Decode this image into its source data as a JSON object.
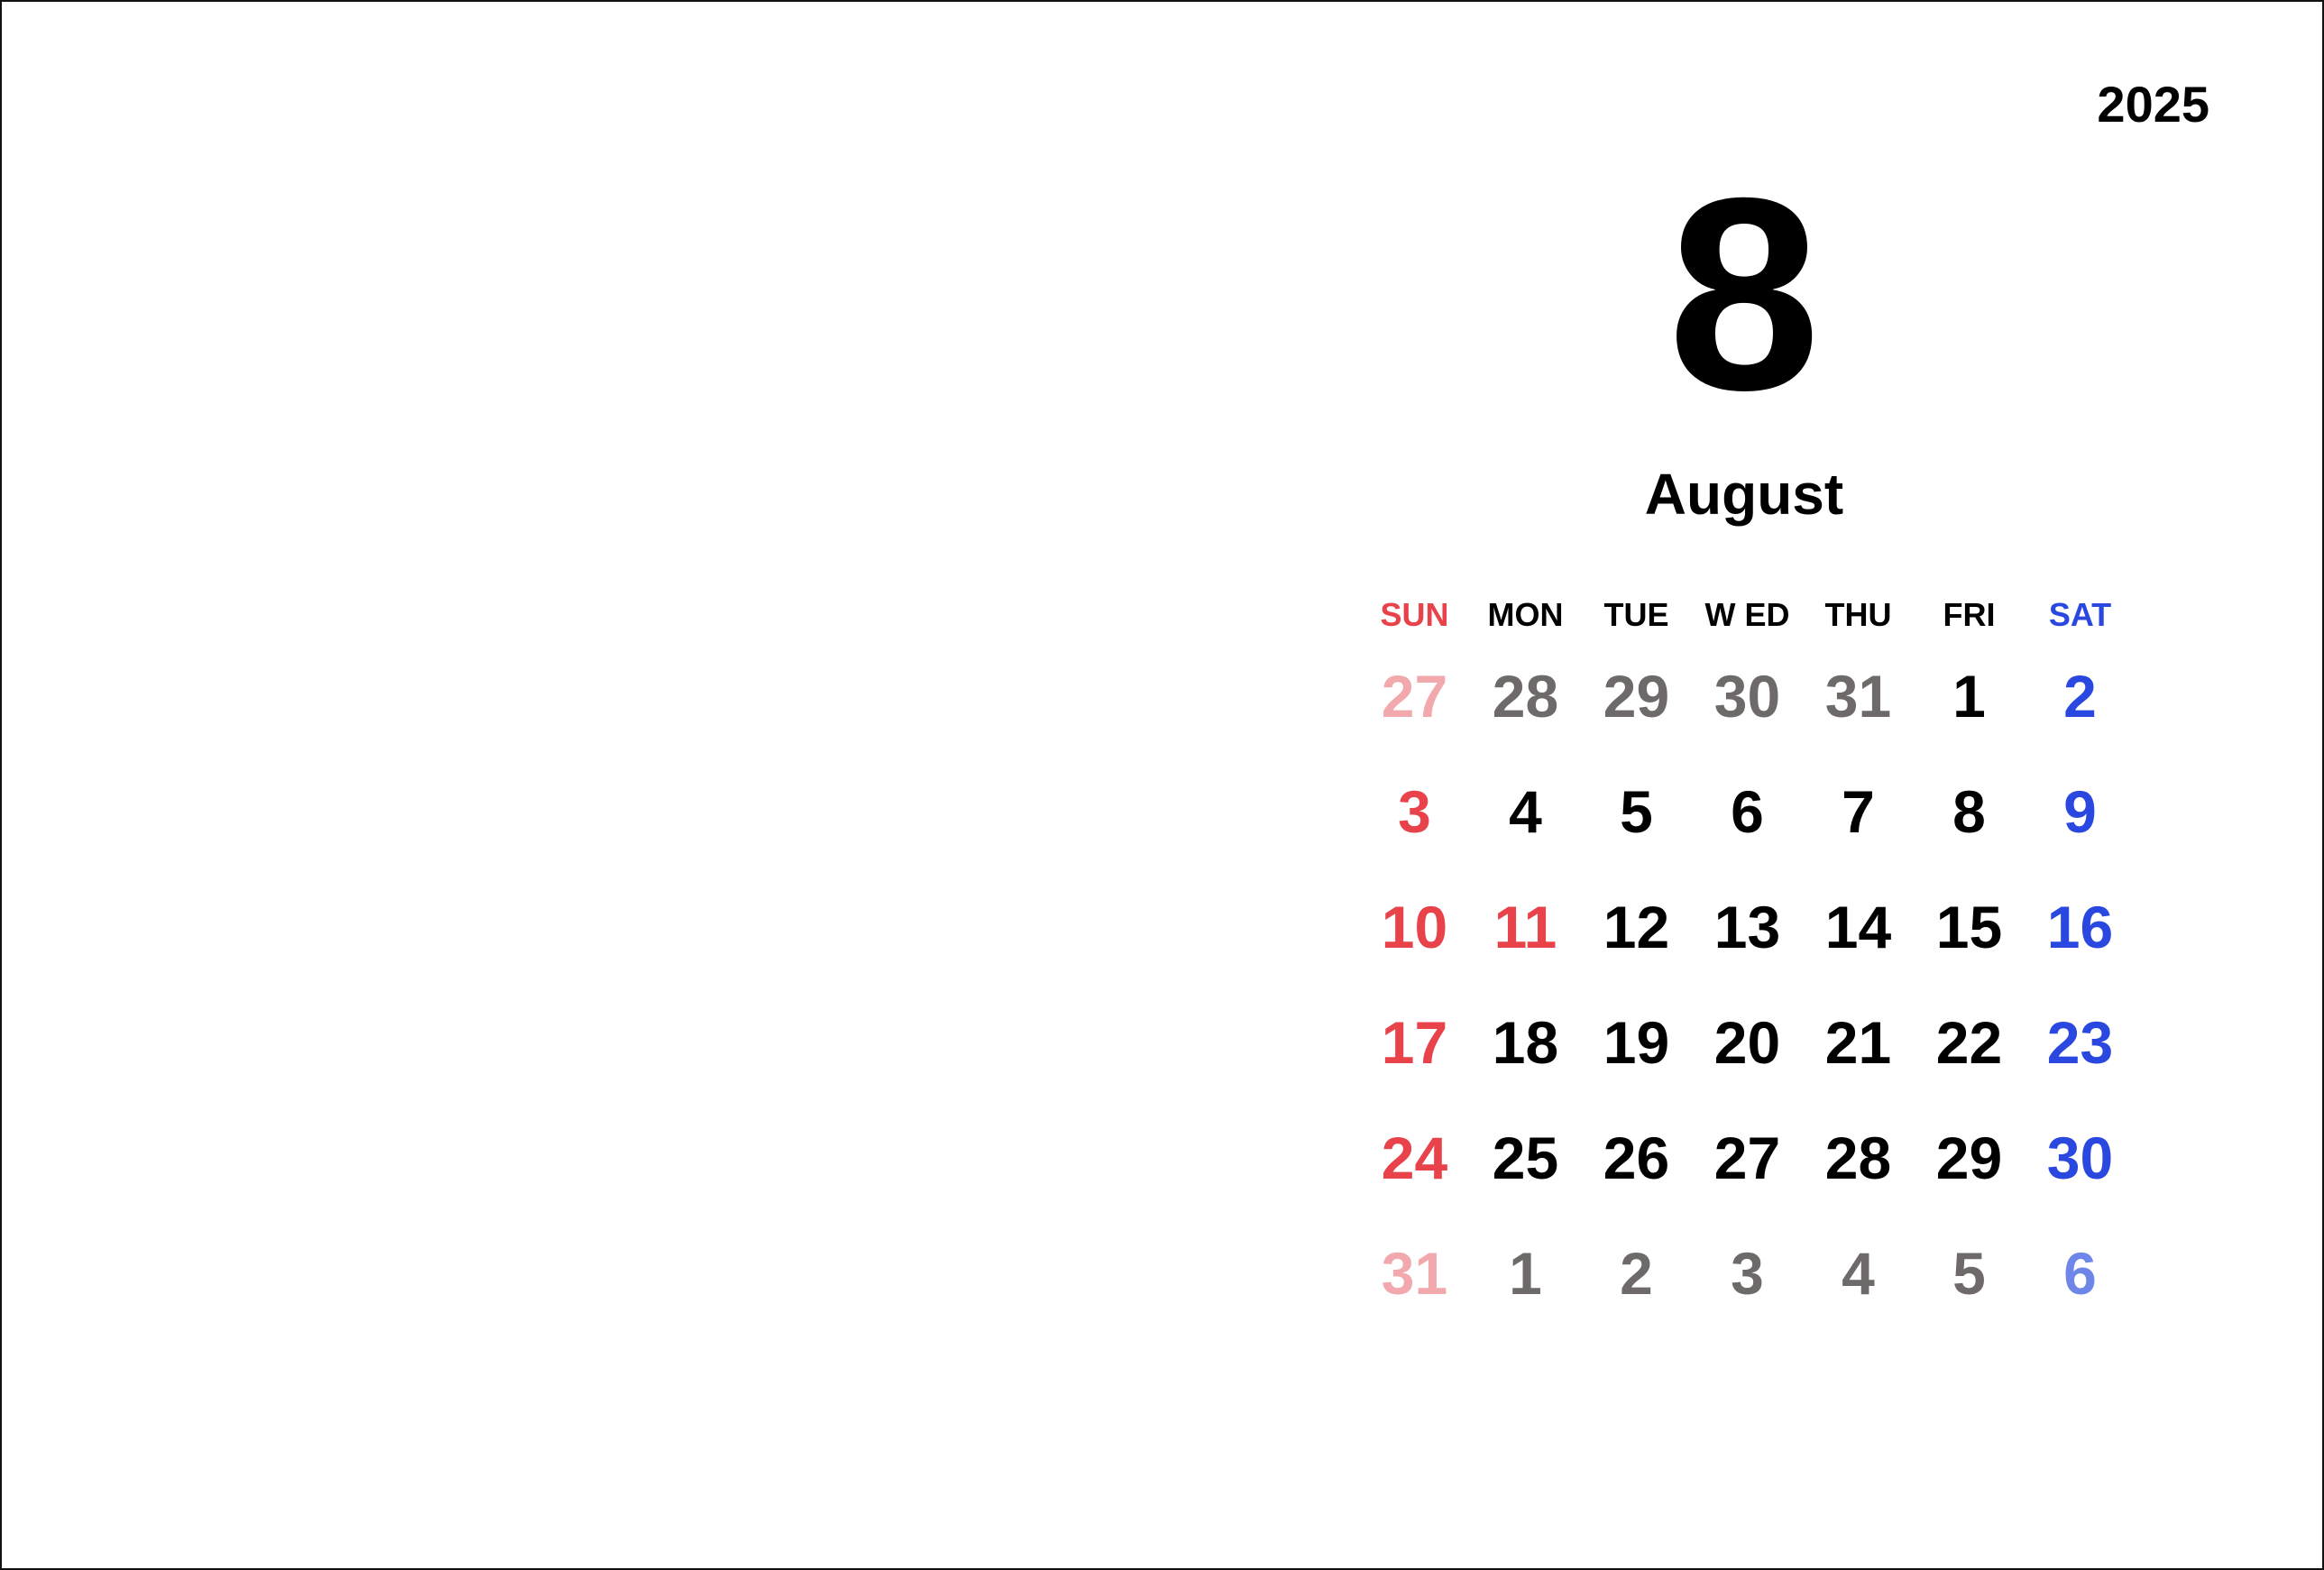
{
  "year": "2025",
  "month_number": "8",
  "month_name": "August",
  "colors": {
    "normal": "#000000",
    "sunday": "#e8424a",
    "saturday": "#2a48e0",
    "other_month": "#6e6a6a",
    "other_sunday": "#f2a9ad",
    "other_saturday": "#6e86e8"
  },
  "weekdays": [
    {
      "label": "SUN",
      "color": "#e8424a"
    },
    {
      "label": "MON",
      "color": "#000000"
    },
    {
      "label": "TUE",
      "color": "#000000"
    },
    {
      "label": "W ED",
      "color": "#000000"
    },
    {
      "label": "THU",
      "color": "#000000"
    },
    {
      "label": "FRI",
      "color": "#000000"
    },
    {
      "label": "SAT",
      "color": "#2a48e0"
    }
  ],
  "weeks": [
    [
      {
        "day": "27",
        "color": "#f2a9ad"
      },
      {
        "day": "28",
        "color": "#6e6a6a"
      },
      {
        "day": "29",
        "color": "#6e6a6a"
      },
      {
        "day": "30",
        "color": "#6e6a6a"
      },
      {
        "day": "31",
        "color": "#6e6a6a"
      },
      {
        "day": "1",
        "color": "#000000"
      },
      {
        "day": "2",
        "color": "#2a48e0"
      }
    ],
    [
      {
        "day": "3",
        "color": "#e8424a"
      },
      {
        "day": "4",
        "color": "#000000"
      },
      {
        "day": "5",
        "color": "#000000"
      },
      {
        "day": "6",
        "color": "#000000"
      },
      {
        "day": "7",
        "color": "#000000"
      },
      {
        "day": "8",
        "color": "#000000"
      },
      {
        "day": "9",
        "color": "#2a48e0"
      }
    ],
    [
      {
        "day": "10",
        "color": "#e8424a"
      },
      {
        "day": "11",
        "color": "#e8424a"
      },
      {
        "day": "12",
        "color": "#000000"
      },
      {
        "day": "13",
        "color": "#000000"
      },
      {
        "day": "14",
        "color": "#000000"
      },
      {
        "day": "15",
        "color": "#000000"
      },
      {
        "day": "16",
        "color": "#2a48e0"
      }
    ],
    [
      {
        "day": "17",
        "color": "#e8424a"
      },
      {
        "day": "18",
        "color": "#000000"
      },
      {
        "day": "19",
        "color": "#000000"
      },
      {
        "day": "20",
        "color": "#000000"
      },
      {
        "day": "21",
        "color": "#000000"
      },
      {
        "day": "22",
        "color": "#000000"
      },
      {
        "day": "23",
        "color": "#2a48e0"
      }
    ],
    [
      {
        "day": "24",
        "color": "#e8424a"
      },
      {
        "day": "25",
        "color": "#000000"
      },
      {
        "day": "26",
        "color": "#000000"
      },
      {
        "day": "27",
        "color": "#000000"
      },
      {
        "day": "28",
        "color": "#000000"
      },
      {
        "day": "29",
        "color": "#000000"
      },
      {
        "day": "30",
        "color": "#2a48e0"
      }
    ],
    [
      {
        "day": "31",
        "color": "#f2a9ad"
      },
      {
        "day": "1",
        "color": "#6e6a6a"
      },
      {
        "day": "2",
        "color": "#6e6a6a"
      },
      {
        "day": "3",
        "color": "#6e6a6a"
      },
      {
        "day": "4",
        "color": "#6e6a6a"
      },
      {
        "day": "5",
        "color": "#6e6a6a"
      },
      {
        "day": "6",
        "color": "#6e86e8"
      }
    ]
  ]
}
